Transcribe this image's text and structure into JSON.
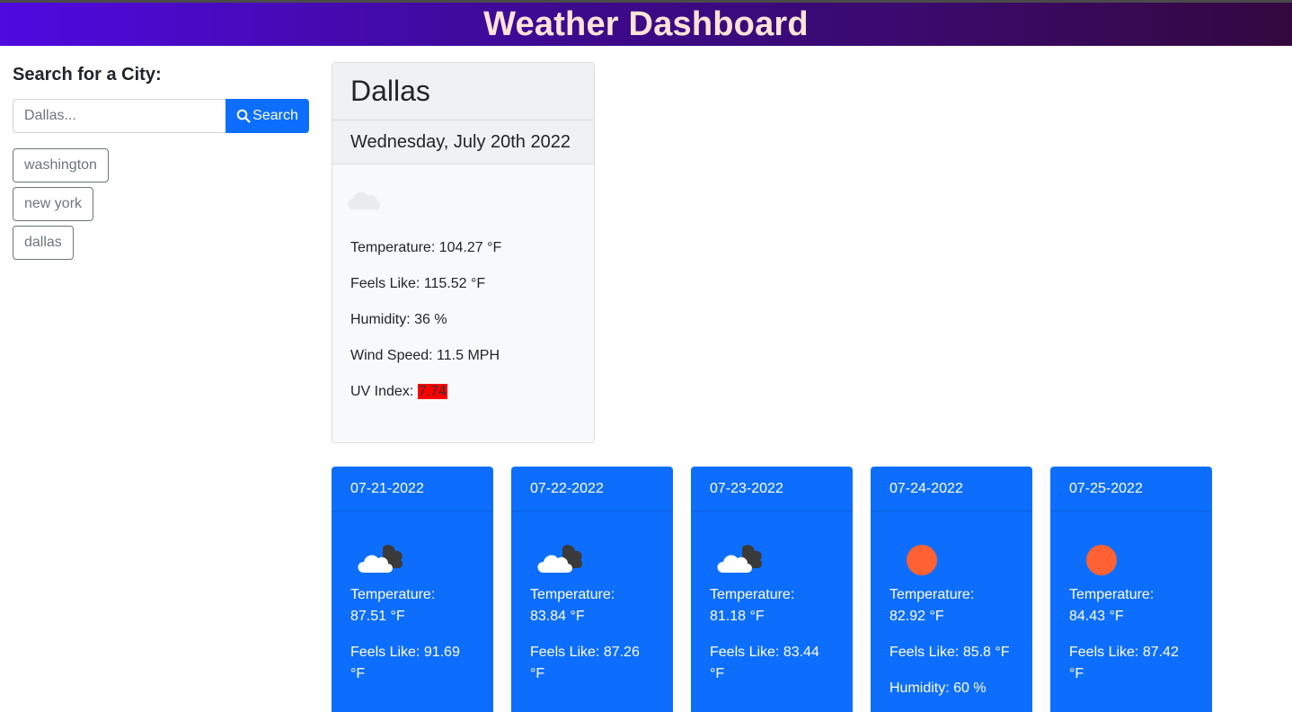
{
  "header": {
    "title": "Weather Dashboard"
  },
  "sidebar": {
    "heading": "Search for a City:",
    "search": {
      "placeholder": "Dallas...",
      "value": "",
      "button_label": "Search"
    },
    "history": [
      "washington",
      "new york",
      "dallas"
    ]
  },
  "current": {
    "city": "Dallas",
    "date": "Wednesday, July 20th 2022",
    "icon": "cloud-icon",
    "temperature": "Temperature: 104.27 °F",
    "feels_like": "Feels Like: 115.52 °F",
    "humidity": "Humidity: 36 %",
    "wind": "Wind Speed: 11.5 MPH",
    "uv_label": "UV Index:",
    "uv_value": "7.74",
    "uv_color": "#ff0000"
  },
  "forecast": [
    {
      "date": "07-21-2022",
      "icon": "cloudy-icon",
      "temp_label": "Temperature:",
      "temp": "87.51 °F",
      "feels": "Feels Like: 91.69 °F"
    },
    {
      "date": "07-22-2022",
      "icon": "cloudy-icon",
      "temp_label": "Temperature:",
      "temp": "83.84 °F",
      "feels": "Feels Like: 87.26 °F"
    },
    {
      "date": "07-23-2022",
      "icon": "cloudy-icon",
      "temp_label": "Temperature:",
      "temp": "81.18 °F",
      "feels": "Feels Like: 83.44 °F"
    },
    {
      "date": "07-24-2022",
      "icon": "sun-icon",
      "temp_label": "Temperature:",
      "temp": "82.92 °F",
      "feels": "Feels Like: 85.8 °F",
      "humidity": "Humidity: 60 %"
    },
    {
      "date": "07-25-2022",
      "icon": "sun-icon",
      "temp_label": "Temperature:",
      "temp": "84.43 °F",
      "feels": "Feels Like: 87.42 °F"
    }
  ],
  "colors": {
    "accent": "#0d6efd",
    "header_start": "#4f0ae0",
    "header_end": "#33083f",
    "sun": "#ff6132"
  }
}
